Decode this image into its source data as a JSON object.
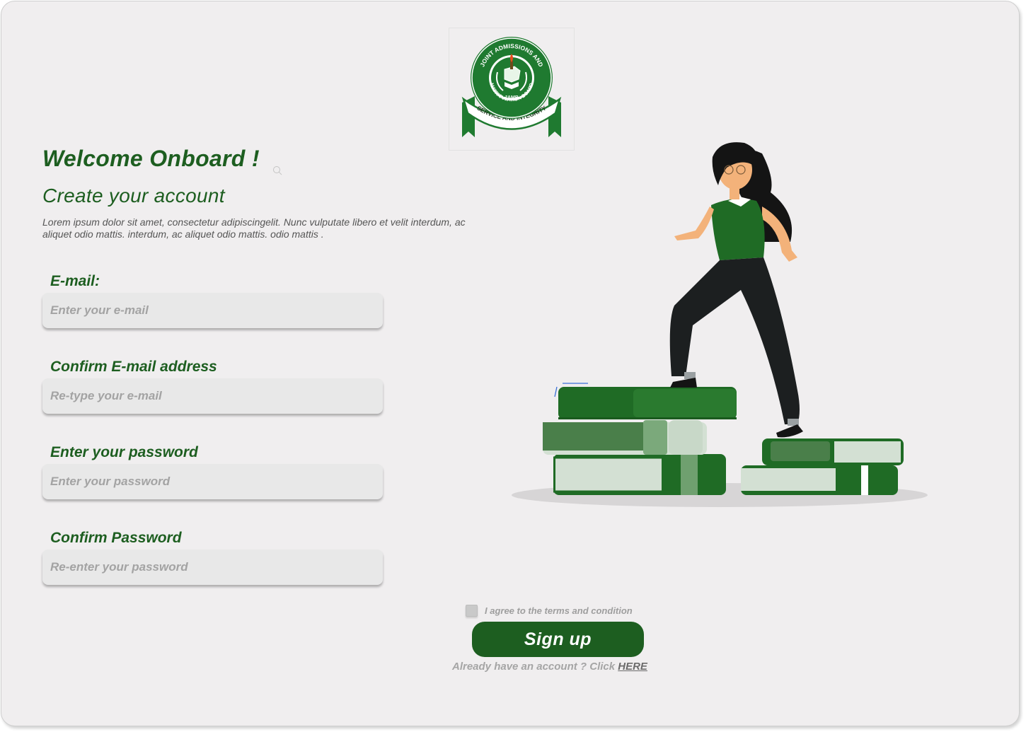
{
  "logo": {
    "arc_top": "JOINT ADMISSIONS AND",
    "arc_mid": "MATRICULATION BOARD",
    "abbr": "JAMB",
    "ribbon": "SERVICE AND INTEGRITY"
  },
  "header": {
    "welcome": "Welcome Onboard !",
    "subtitle": "Create your account",
    "description": "Lorem ipsum dolor sit amet, consectetur adipiscingelit. Nunc vulputate libero et velit interdum, ac aliquet odio mattis. interdum, ac aliquet odio mattis. odio mattis ."
  },
  "form": {
    "email": {
      "label": "E-mail:",
      "placeholder": "Enter your e-mail"
    },
    "confirm_email": {
      "label": "Confirm E-mail address",
      "placeholder": "Re-type your e-mail"
    },
    "password": {
      "label": "Enter your password",
      "placeholder": "Enter your password"
    },
    "confirm_password": {
      "label": "Confirm Password",
      "placeholder": "Re-enter your password"
    }
  },
  "terms": {
    "label": "I agree to the terms and condition",
    "checked": false
  },
  "signup_button": "Sign up",
  "signin": {
    "prefix": "Already have an account ? Click ",
    "link": "HERE"
  },
  "colors": {
    "brand_green": "#1d5e20",
    "background": "#f0eeef",
    "input_bg": "#e8e8e8"
  },
  "icons": [
    "jamb-logo",
    "search-icon",
    "woman-climbing-books-illustration"
  ]
}
